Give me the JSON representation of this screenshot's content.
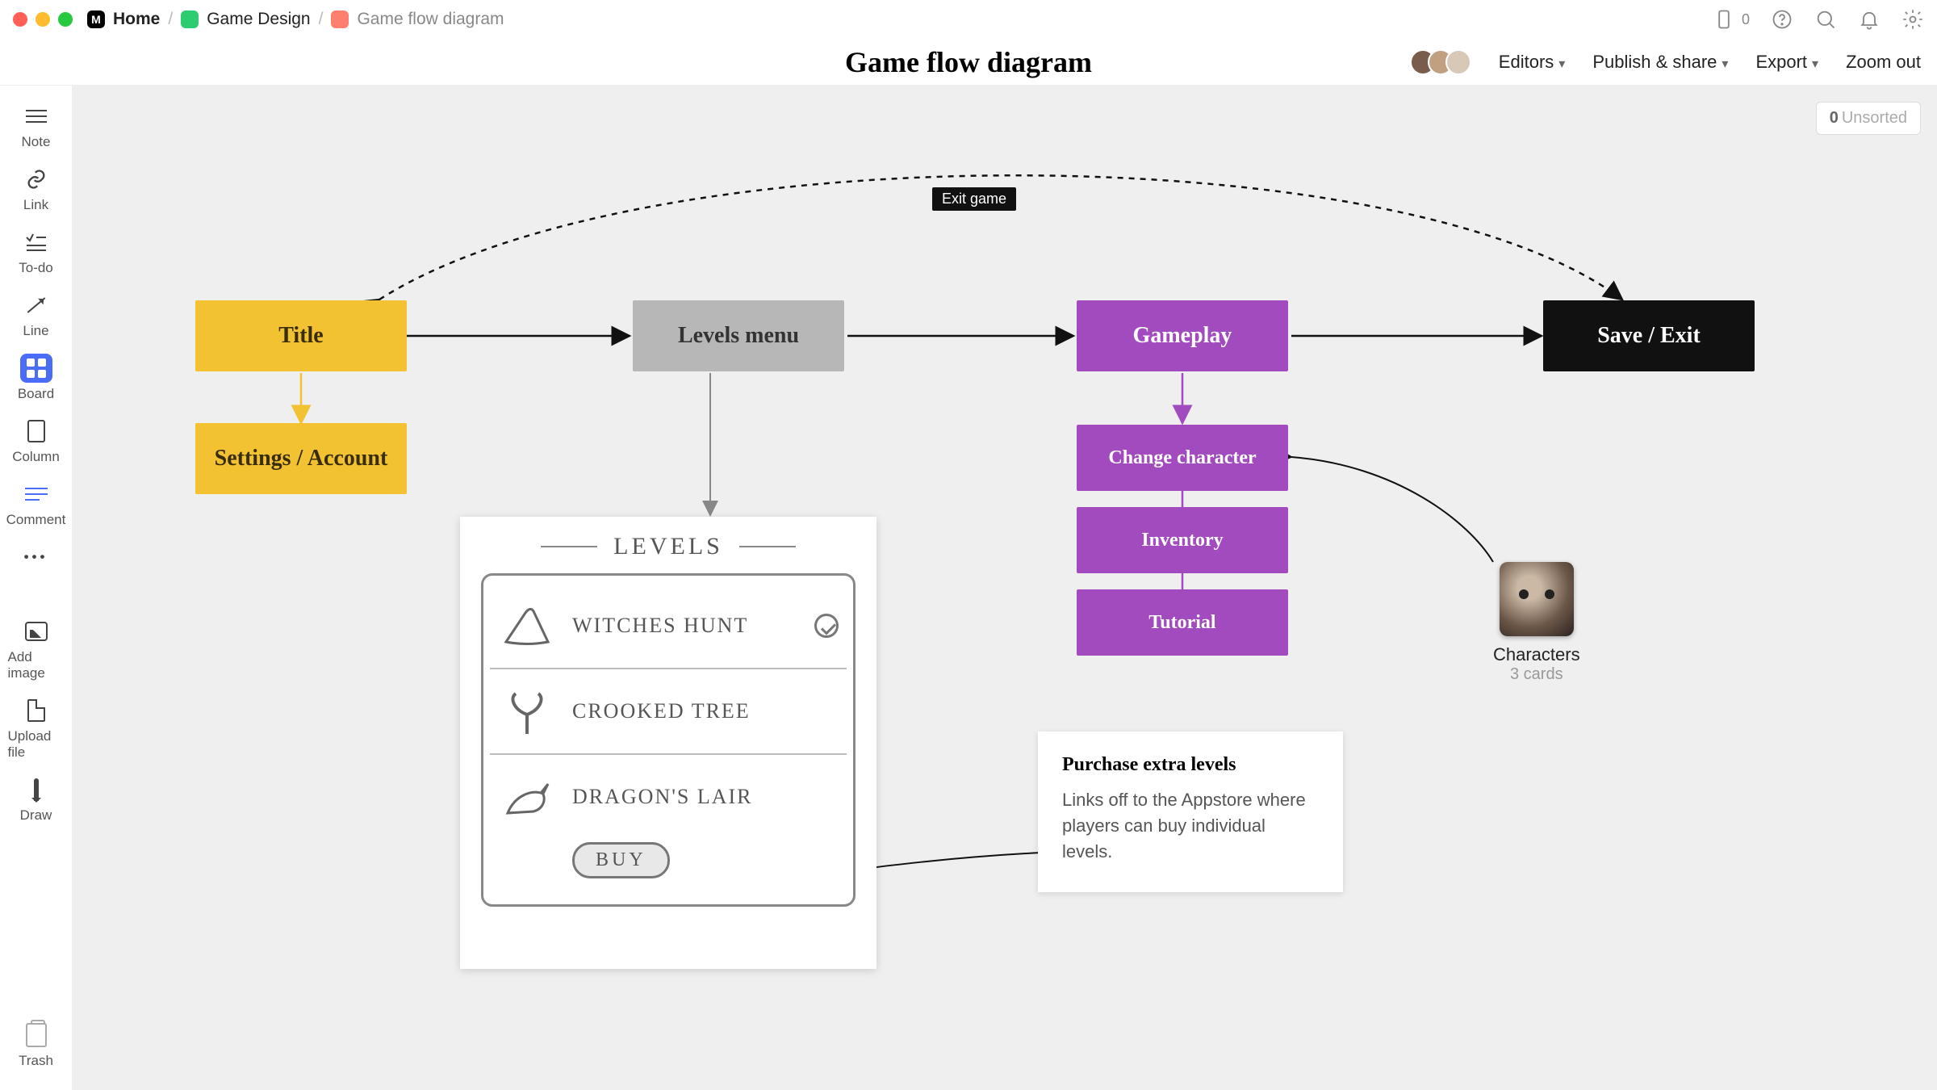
{
  "breadcrumbs": {
    "home": "Home",
    "project": "Game Design",
    "doc": "Game flow diagram"
  },
  "doc_title": "Game flow diagram",
  "header": {
    "editors": "Editors",
    "publish": "Publish & share",
    "export": "Export",
    "zoom_out": "Zoom out",
    "mobile_count": "0"
  },
  "unsorted": {
    "count": "0",
    "label": "Unsorted"
  },
  "tools": {
    "note": "Note",
    "link": "Link",
    "todo": "To-do",
    "line": "Line",
    "board": "Board",
    "column": "Column",
    "comment": "Comment",
    "more": "•••",
    "add_image": "Add image",
    "upload": "Upload file",
    "draw": "Draw",
    "trash": "Trash"
  },
  "nodes": {
    "title": "Title",
    "settings": "Settings / Account",
    "levels_menu": "Levels menu",
    "gameplay": "Gameplay",
    "change_char": "Change character",
    "inventory": "Inventory",
    "tutorial": "Tutorial",
    "save_exit": "Save / Exit"
  },
  "exit_label": "Exit game",
  "note": {
    "title": "Purchase extra levels",
    "body": "Links off to the Appstore where players can buy individual levels."
  },
  "characters": {
    "title": "Characters",
    "sub": "3 cards"
  },
  "sketch": {
    "heading": "LEVELS",
    "rows": [
      "WITCHES HUNT",
      "CROOKED TREE",
      "DRAGON'S LAIR"
    ],
    "buy": "BUY"
  }
}
